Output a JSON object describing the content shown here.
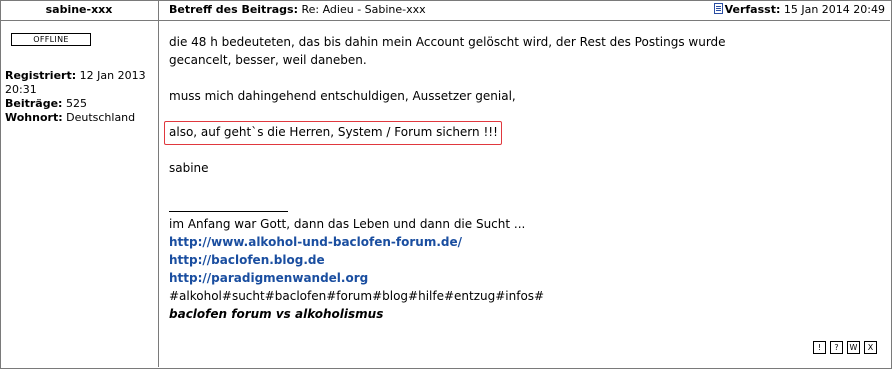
{
  "author": {
    "name": "sabine-xxx",
    "status": "OFFLINE",
    "registered_label": "Registriert:",
    "registered_value": "12 Jan 2013 20:31",
    "posts_label": "Beiträge:",
    "posts_value": "525",
    "location_label": "Wohnort:",
    "location_value": "Deutschland"
  },
  "header": {
    "subject_label": "Betreff des Beitrags:",
    "subject_value": "Re: Adieu - Sabine-xxx",
    "posted_label": "Verfasst:",
    "posted_value": "15 Jan 2014 20:49"
  },
  "post": {
    "line1": "die 48 h bedeuteten, das bis dahin mein Account gelöscht wird, der Rest des Postings wurde",
    "line2": "gecancelt, besser, weil daneben.",
    "line3": "muss mich dahingehend entschuldigen, Aussetzer genial,",
    "line4": "also, auf geht`s die Herren, System / Forum sichern !!!",
    "line5": "sabine"
  },
  "signature": {
    "intro": "im Anfang war Gott, dann das Leben und dann die Sucht ...",
    "link1": "http://www.alkohol-und-baclofen-forum.de/",
    "link2": "http://baclofen.blog.de",
    "link3": "http://paradigmenwandel.org",
    "tags": "#alkohol#sucht#baclofen#forum#blog#hilfe#entzug#infos#",
    "tagline": "baclofen forum vs alkoholismus"
  },
  "actions": {
    "report": "!",
    "info": "?",
    "warn": "W",
    "delete": "X"
  },
  "colors": {
    "link": "#1a4ea0",
    "highlight": "#e0383e",
    "border": "#7a7a7a"
  }
}
